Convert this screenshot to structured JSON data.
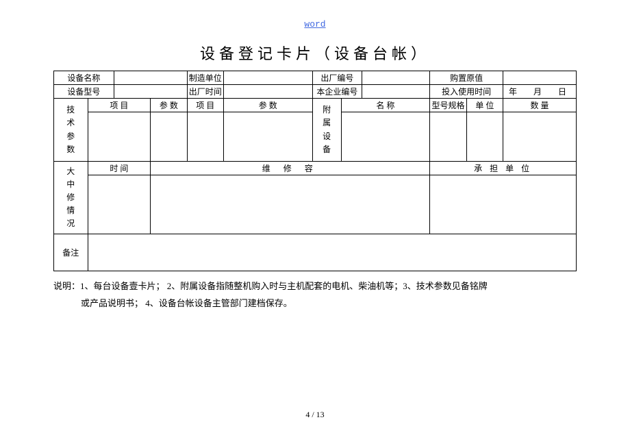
{
  "header": "word",
  "title": "设备登记卡片（设备台帐）",
  "row1": {
    "c1": "设备名称",
    "c2": "",
    "c3": "制造单位",
    "c4": "",
    "c5": "出厂编号",
    "c6": "",
    "c7": "购置原值",
    "c8": ""
  },
  "row2": {
    "c1": "设备型号",
    "c2": "",
    "c3": "出厂时间",
    "c4": "",
    "c5": "本企业编号",
    "c6": "",
    "c7": "投入使用时间",
    "c8": "年　月　日"
  },
  "section_tech": {
    "label_chars": [
      "技",
      "术",
      "参",
      "数"
    ],
    "h1": "项 目",
    "h2": "参 数",
    "h3": "项 目",
    "h4": "参 数"
  },
  "section_attach": {
    "label_chars": [
      "附",
      "属",
      "设",
      "备"
    ],
    "h1": "名 称",
    "h2": "型号规格",
    "h3": "单 位",
    "h4": "数 量"
  },
  "section_repair": {
    "label_chars": [
      "大",
      "中",
      "修",
      "情",
      "况"
    ],
    "h1": "时 间",
    "h2": "维 修 容",
    "h3": "承 担 单 位"
  },
  "section_remark": {
    "label": "备注"
  },
  "notes_line1": "说明：1、每台设备壹卡片； 2、附属设备指随整机购入时与主机配套的电机、柴油机等；3、技术参数见备铭牌",
  "notes_line2": "或产品说明书； 4、设备台帐设备主管部门建档保存。",
  "page": "4 / 13"
}
